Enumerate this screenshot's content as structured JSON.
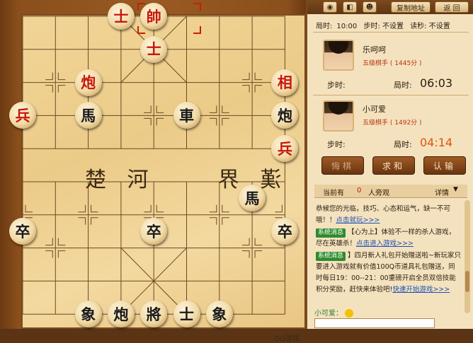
{
  "board": {
    "river_left": "楚 河",
    "river_right": "漢 界",
    "watermark": "QQ游戏",
    "pieces": [
      {
        "id": "r-shuai",
        "label": "帥",
        "side": "red",
        "col": 4,
        "row": 0
      },
      {
        "id": "r-shi-1",
        "label": "士",
        "side": "red",
        "col": 3,
        "row": 0
      },
      {
        "id": "r-shi-2",
        "label": "士",
        "side": "red",
        "col": 4,
        "row": 1
      },
      {
        "id": "r-pao",
        "label": "炮",
        "side": "red",
        "col": 2,
        "row": 2
      },
      {
        "id": "r-xiang",
        "label": "相",
        "side": "red",
        "col": 8,
        "row": 2
      },
      {
        "id": "r-bing-1",
        "label": "兵",
        "side": "red",
        "col": 0,
        "row": 3
      },
      {
        "id": "r-bing-2",
        "label": "兵",
        "side": "red",
        "col": 8,
        "row": 4
      },
      {
        "id": "b-ma-1",
        "label": "馬",
        "side": "black",
        "col": 2,
        "row": 3
      },
      {
        "id": "b-che",
        "label": "車",
        "side": "black",
        "col": 5,
        "row": 3
      },
      {
        "id": "b-pao-1",
        "label": "炮",
        "side": "black",
        "col": 8,
        "row": 3
      },
      {
        "id": "b-ma-2",
        "label": "馬",
        "side": "black",
        "col": 7,
        "row": 5.5
      },
      {
        "id": "b-zu-1",
        "label": "卒",
        "side": "black",
        "col": 0,
        "row": 6.5
      },
      {
        "id": "b-zu-2",
        "label": "卒",
        "side": "black",
        "col": 4,
        "row": 6.5
      },
      {
        "id": "b-zu-3",
        "label": "卒",
        "side": "black",
        "col": 8,
        "row": 6.5
      },
      {
        "id": "b-xiang-1",
        "label": "象",
        "side": "black",
        "col": 2,
        "row": 9
      },
      {
        "id": "b-pao-2",
        "label": "炮",
        "side": "black",
        "col": 3,
        "row": 9
      },
      {
        "id": "b-jiang",
        "label": "將",
        "side": "black",
        "col": 4,
        "row": 9
      },
      {
        "id": "b-shi",
        "label": "士",
        "side": "black",
        "col": 5,
        "row": 9
      },
      {
        "id": "b-xiang-2",
        "label": "象",
        "side": "black",
        "col": 6,
        "row": 9
      }
    ]
  },
  "panel": {
    "toolbar": {
      "copy_url": "复制地址",
      "back": "返 回"
    },
    "settings": {
      "game_time_label": "局时:",
      "game_time": "10:00",
      "step_time": "步时: 不设置",
      "countdown": "读秒: 不设置"
    },
    "player_top": {
      "name": "乐呵呵",
      "rank": "五级棋手",
      "score": "( 1445分 )",
      "step_label": "步时:",
      "time_label": "局时:",
      "time": "06:03"
    },
    "player_bottom": {
      "name": "小可爱",
      "rank": "五级棋手",
      "score": "( 1492分 )",
      "step_label": "步时:",
      "time_label": "局时:",
      "time": "04:14"
    },
    "actions": {
      "undo": "悔棋",
      "draw": "求和",
      "resign": "认输"
    },
    "lobby": {
      "prefix": "当前有",
      "count": "0",
      "suffix": "人旁观",
      "detail": "详情"
    },
    "chat": {
      "welcome": "恭候您的光临，技巧、心态和运气，缺一不可哦！！",
      "welcome_link": "点击就玩>>>",
      "sys_label": "系统消息",
      "msg1": "【心为上】体验不一样的杀人游戏，尽在英雄杀！",
      "msg1_link": "点击进入游戏>>>",
      "msg2": "】四月新人礼包开始赠送啦~新玩家只要进入游戏就有价值100Q币道具礼包赠送，同时每日19：00--21：00重磅开启全员双倍技能积分奖励，赶快来体验吧!",
      "msg2_link": "快速开始游戏>>>",
      "sender": "小可爱："
    }
  }
}
